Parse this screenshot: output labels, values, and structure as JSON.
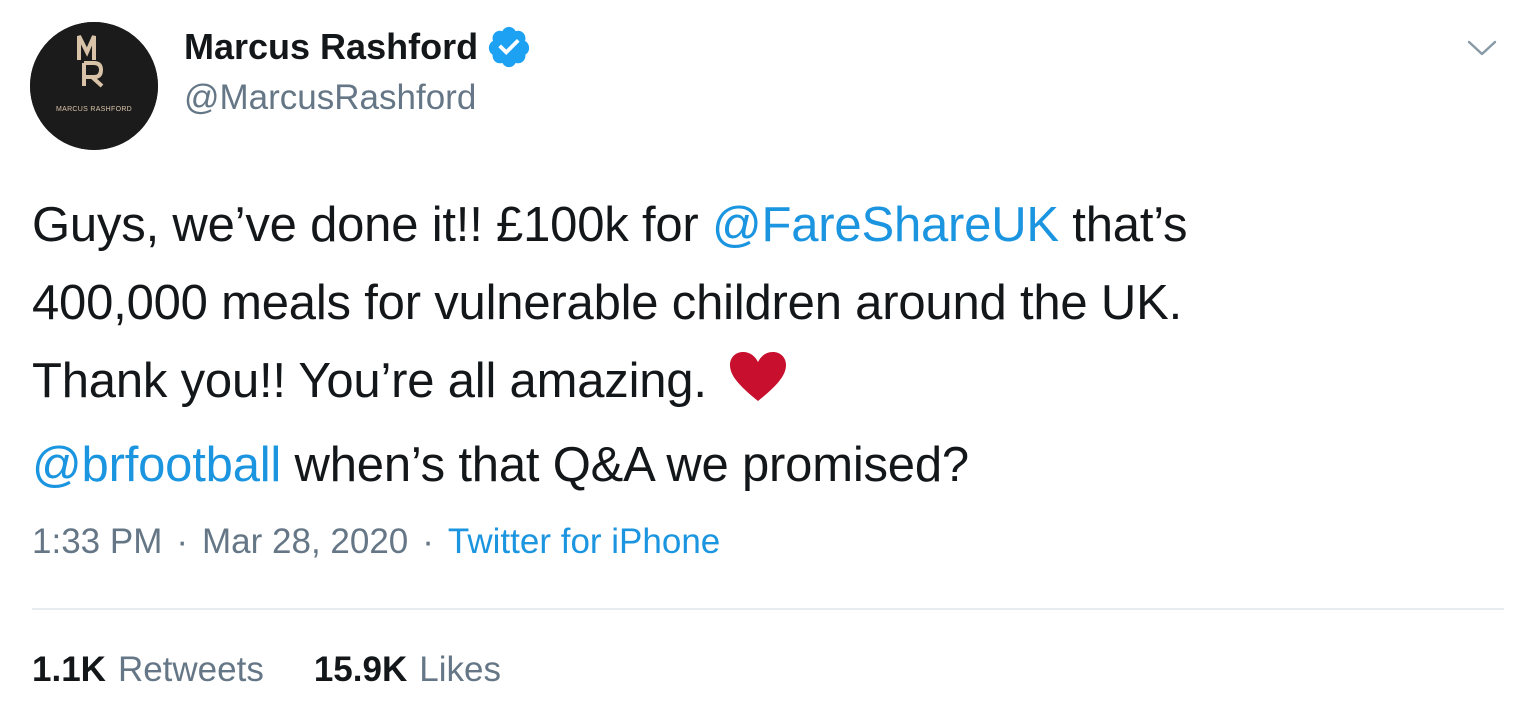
{
  "author": {
    "name": "Marcus Rashford",
    "handle": "@MarcusRashford",
    "verified": true,
    "avatar_text": "MARCUS RASHFORD",
    "avatar_monogram": "MR"
  },
  "tweet": {
    "lines": [
      [
        {
          "text": "Guys, we’ve done it!! £100k for ",
          "type": "text"
        },
        {
          "text": "@FareShareUK",
          "type": "mention"
        },
        {
          "text": " that’s",
          "type": "text"
        }
      ],
      [
        {
          "text": "400,000 meals for vulnerable children around the UK.",
          "type": "text"
        }
      ],
      [
        {
          "text": "Thank you!! You’re all amazing. ",
          "type": "text"
        }
      ],
      [
        {
          "text": "@brfootball",
          "type": "mention"
        },
        {
          "text": " when’s that Q&A we promised?",
          "type": "text"
        }
      ]
    ],
    "emoji": "red-heart-icon"
  },
  "meta": {
    "time": "1:33 PM",
    "separator": "·",
    "date": "Mar 28, 2020",
    "source": "Twitter for iPhone"
  },
  "stats": {
    "retweets_count": "1.1K",
    "retweets_label": "Retweets",
    "likes_count": "15.9K",
    "likes_label": "Likes"
  },
  "colors": {
    "text": "#14171a",
    "secondary": "#657786",
    "link": "#1b95e0",
    "verified": "#1da1f2",
    "heart": "#c8102e",
    "divider": "#e6ecf0"
  }
}
